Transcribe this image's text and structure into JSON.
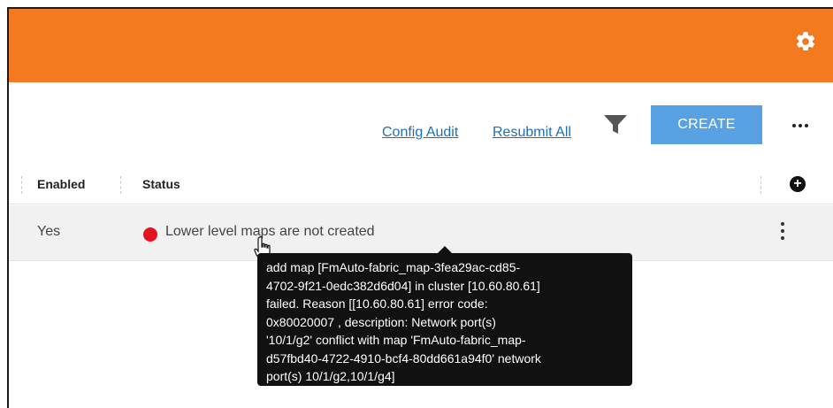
{
  "toolbar": {
    "config_audit_label": "Config Audit",
    "resubmit_all_label": "Resubmit All",
    "create_label": "CREATE"
  },
  "icons": {
    "settings": "gear-icon",
    "filter": "filter-icon",
    "more": "more-horizontal-icon",
    "add_column": "add-circle-icon",
    "row_menu": "more-vertical-icon",
    "cursor": "hand-pointer-icon"
  },
  "colors": {
    "topbar": "#f37a1f",
    "create_button": "#58a1e3",
    "link": "#1e6fb8",
    "status_error": "#e8121e",
    "tooltip_bg": "#111111"
  },
  "table": {
    "columns": [
      "Enabled",
      "Status"
    ],
    "rows": [
      {
        "enabled": "Yes",
        "status": "Lower level maps are not created"
      }
    ]
  },
  "tooltip": {
    "lines": [
      "add map [FmAuto-fabric_map-3fea29ac-cd85-",
      "4702-9f21-0edc382d6d04] in cluster [10.60.80.61]",
      "failed. Reason [[10.60.80.61] error code:",
      "0x80020007 , description: Network port(s)",
      "'10/1/g2' conflict with map 'FmAuto-fabric_map-",
      "d57fbd40-4722-4910-bcf4-80dd661a94f0' network",
      "port(s) 10/1/g2,10/1/g4]"
    ]
  }
}
